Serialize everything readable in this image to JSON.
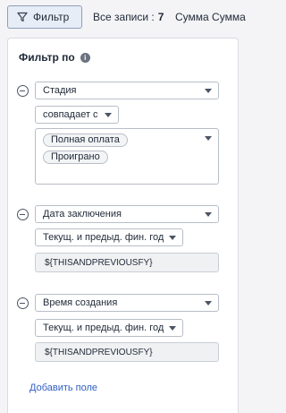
{
  "toolbar": {
    "filter_label": "Фильтр",
    "records_label": "Все записи :",
    "records_count": "7",
    "sum_label": "Сумма Сумма"
  },
  "panel": {
    "title": "Фильтр по",
    "add_field_label": "Добавить поле",
    "rules": [
      {
        "field": "Стадия",
        "operator": "совпадает с",
        "values": [
          "Полная оплата",
          "Проиграно"
        ]
      },
      {
        "field": "Дата заключения",
        "operator": "Текущ. и предыд. фин. год",
        "value": "${THISANDPREVIOUSFY}"
      },
      {
        "field": "Время создания",
        "operator": "Текущ. и предыд. фин. год",
        "value": "${THISANDPREVIOUSFY}"
      }
    ]
  },
  "icons": {
    "filter": "filter-icon",
    "info": "info-icon",
    "remove": "remove-circle-icon",
    "caret": "chevron-down-icon"
  }
}
